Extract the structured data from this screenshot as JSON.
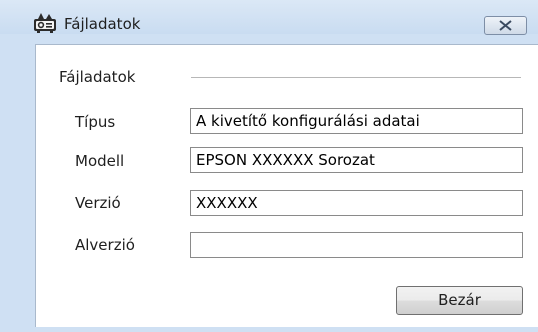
{
  "window": {
    "title": "Fájladatok",
    "title_icon": "projector-icon",
    "close_icon": "close-icon"
  },
  "group": {
    "label": "Fájladatok"
  },
  "rows": [
    {
      "label": "Típus",
      "value": "A kivetítő konfigurálási adatai"
    },
    {
      "label": "Modell",
      "value": "EPSON XXXXXX Sorozat"
    },
    {
      "label": "Verzió",
      "value": "XXXXXX"
    },
    {
      "label": "Alverzió",
      "value": ""
    }
  ],
  "footer": {
    "close_label": "Bezár"
  }
}
